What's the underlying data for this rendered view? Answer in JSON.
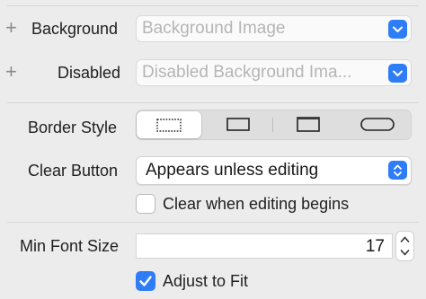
{
  "rows": {
    "background": {
      "label": "Background",
      "placeholder": "Background Image",
      "plus": "+"
    },
    "disabled": {
      "label": "Disabled",
      "placeholder": "Disabled Background Ima...",
      "plus": "+"
    },
    "border_style": {
      "label": "Border Style",
      "options": [
        "none",
        "line",
        "bezel",
        "rounded-rect"
      ],
      "selected": "none"
    },
    "clear_button": {
      "label": "Clear Button",
      "value": "Appears unless editing"
    },
    "clear_when_editing": {
      "label": "Clear when editing begins",
      "checked": false
    },
    "min_font_size": {
      "label": "Min Font Size",
      "value": "17"
    },
    "adjust_to_fit": {
      "label": "Adjust to Fit",
      "checked": true
    }
  },
  "colors": {
    "accent": "#2f7df6",
    "panel": "#ececec"
  }
}
